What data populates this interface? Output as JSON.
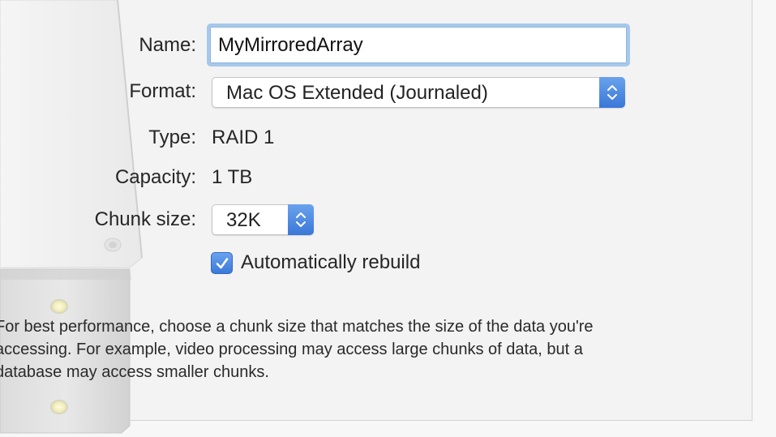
{
  "form": {
    "name_label": "Name:",
    "name_value": "MyMirroredArray",
    "format_label": "Format:",
    "format_value": "Mac OS Extended (Journaled)",
    "type_label": "Type:",
    "type_value": "RAID 1",
    "capacity_label": "Capacity:",
    "capacity_value": "1 TB",
    "chunk_label": "Chunk size:",
    "chunk_value": "32K",
    "rebuild_label": "Automatically rebuild",
    "rebuild_checked": true
  },
  "help": {
    "line1": "For best performance, choose a chunk size that matches the size of the data you're",
    "line2": "accessing. For example, video processing may access large chunks of data, but a",
    "line3": "database may access smaller chunks."
  },
  "colors": {
    "accent": "#3b79d9",
    "focus_ring": "#a6c8ea",
    "background": "#f3f3f3"
  },
  "icons": {
    "stepper": "updown-chevron-icon",
    "checkmark": "checkmark-icon",
    "drive": "raid-drive-icon"
  }
}
